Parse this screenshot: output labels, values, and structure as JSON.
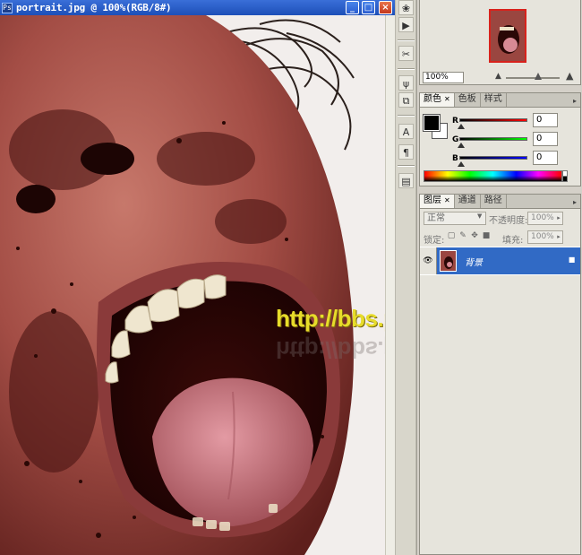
{
  "document": {
    "title": "portrait.jpg @ 100%(RGB/8#)",
    "watermark": "http://bbs.psfeng.cn/",
    "watermark_reflection": "http://bbs.psfeng.cn/"
  },
  "window_buttons": {
    "minimize": "_",
    "maximize": "□",
    "close": "×"
  },
  "toolbar": {
    "tools": [
      "layer-comps-icon",
      "play-icon",
      "scissors-icon",
      "brush-preset-icon",
      "clone-source-icon",
      "character-icon",
      "paragraph-icon",
      "histogram-icon"
    ],
    "glyphs": [
      "❀",
      "▶",
      "✂",
      "ψ",
      "⧉",
      "A",
      "¶",
      "▤"
    ]
  },
  "navigator": {
    "zoom": "100%",
    "zoom_out_glyph": "▲",
    "zoom_in_glyph": "▲"
  },
  "color_panel": {
    "tabs": [
      "颜色",
      "色板",
      "样式"
    ],
    "channels": [
      {
        "name": "R",
        "value": "0"
      },
      {
        "name": "G",
        "value": "0"
      },
      {
        "name": "B",
        "value": "0"
      }
    ],
    "foreground": "#000000",
    "background": "#ffffff"
  },
  "layers_panel": {
    "tabs": [
      "图层",
      "通道",
      "路径"
    ],
    "blend_mode": "正常",
    "opacity_label": "不透明度:",
    "opacity": "100%",
    "lock_label": "锁定:",
    "fill_label": "填充:",
    "fill": "100%",
    "layers": [
      {
        "name": "背景",
        "visible": true,
        "locked": true
      }
    ]
  },
  "colors": {
    "titlebar": "#2458c6",
    "selection": "#316ac5",
    "watermark": "#e7dc2a"
  }
}
